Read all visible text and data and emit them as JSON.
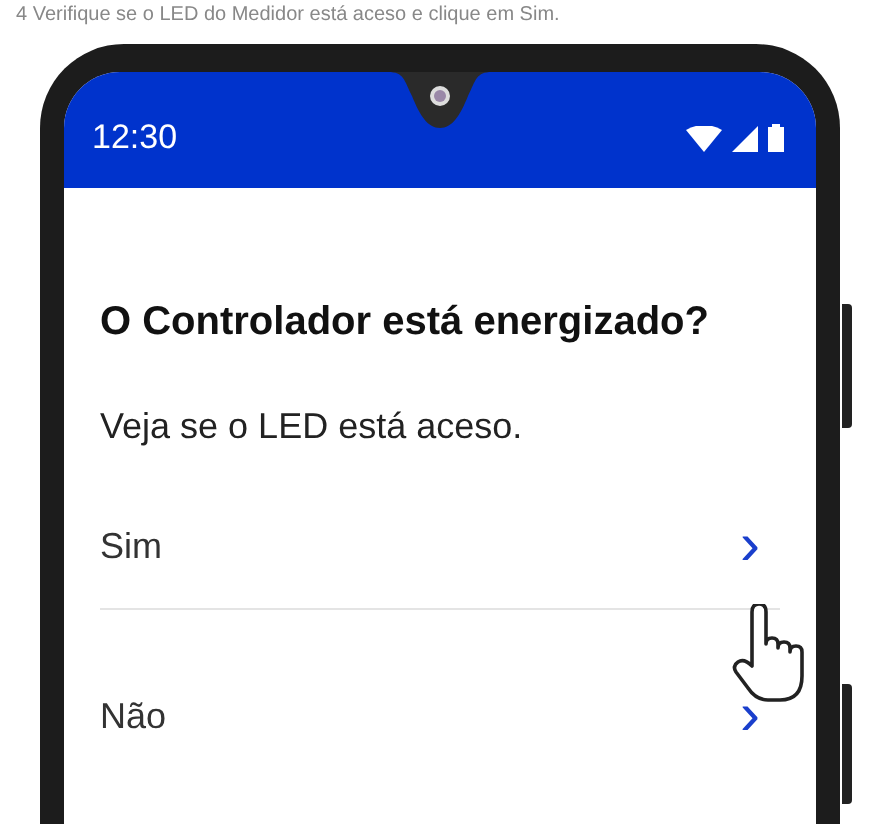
{
  "caption": "4  Verifique se o LED do Medidor está aceso e clique em Sim.",
  "status_bar": {
    "time": "12:30"
  },
  "question": {
    "title": "O Controlador está energizado?",
    "hint": "Veja se o LED está aceso."
  },
  "options": [
    {
      "label": "Sim",
      "chevron": "›"
    },
    {
      "label": "Não",
      "chevron": "›"
    }
  ]
}
